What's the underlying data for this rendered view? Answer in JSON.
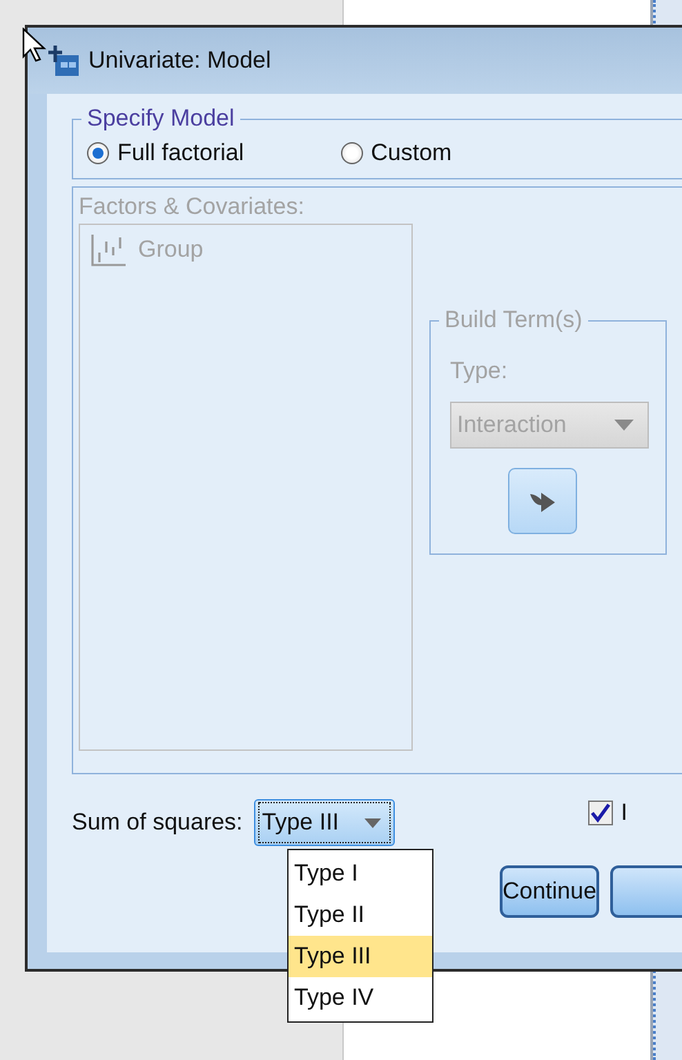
{
  "window": {
    "title": "Univariate: Model"
  },
  "specify_model": {
    "title": "Specify Model",
    "options": [
      {
        "label": "Full factorial",
        "selected": true
      },
      {
        "label": "Custom",
        "selected": false
      }
    ]
  },
  "factors": {
    "label": "Factors & Covariates:",
    "disabled": true,
    "items": [
      {
        "label": "Group"
      }
    ]
  },
  "build_terms": {
    "title": "Build Term(s)",
    "type_label": "Type:",
    "type_value": "Interaction",
    "disabled": true
  },
  "sum_of_squares": {
    "label": "Sum of squares:",
    "value": "Type III",
    "expanded": true,
    "options": [
      {
        "label": "Type I",
        "selected": false
      },
      {
        "label": "Type II",
        "selected": false
      },
      {
        "label": "Type III",
        "selected": true
      },
      {
        "label": "Type IV",
        "selected": false
      }
    ]
  },
  "include_checkbox": {
    "label": "I",
    "checked": true
  },
  "buttons": [
    {
      "kind": "text",
      "label": "Continue"
    },
    {
      "kind": "cut"
    }
  ]
}
